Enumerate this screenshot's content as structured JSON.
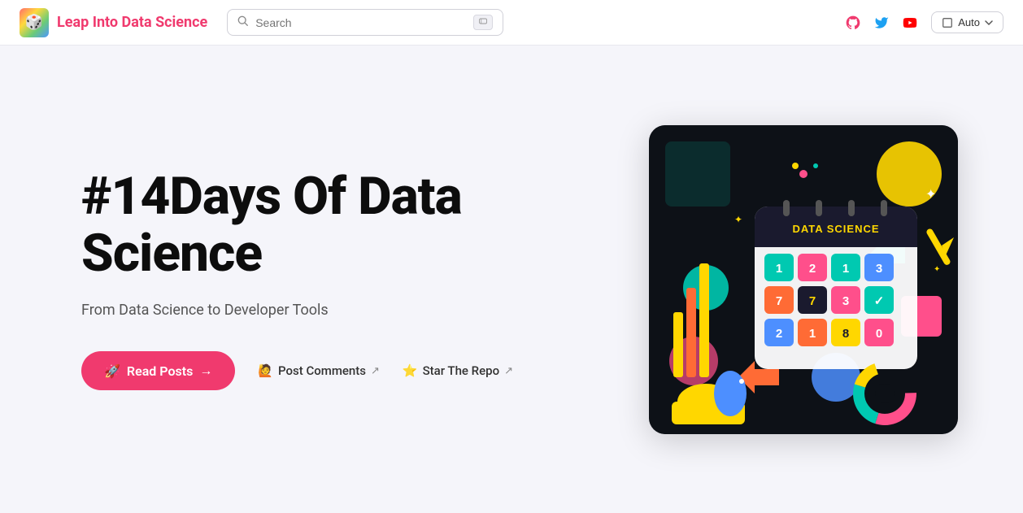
{
  "header": {
    "logo_emoji": "🎲",
    "site_title": "Leap Into Data Science",
    "search_placeholder": "Search",
    "theme_label": "Auto",
    "icons": {
      "github_label": "GitHub",
      "twitter_label": "Twitter",
      "youtube_label": "YouTube"
    }
  },
  "hero": {
    "title": "#14Days Of Data Science",
    "subtitle": "From Data Science to Developer Tools",
    "cta_read_posts": "Read Posts",
    "cta_read_emoji": "🚀",
    "cta_arrow": "→",
    "cta_post_comments": "Post Comments",
    "cta_post_emoji": "🙋",
    "cta_star_repo": "Star The Repo",
    "cta_star_emoji": "⭐"
  }
}
